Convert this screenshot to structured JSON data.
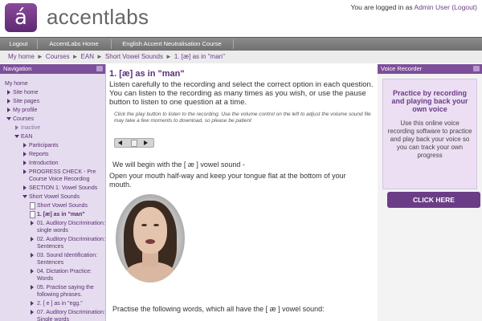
{
  "header": {
    "logo_glyph": "á",
    "logo_text": "accentlabs",
    "login_prefix": "You are logged in as ",
    "user_name": "Admin User",
    "logout_link": "(Logout)"
  },
  "navbar": {
    "items": [
      "Logout",
      "AccentLabs Home",
      "English Accent Neutralisation Course"
    ]
  },
  "breadcrumb": {
    "items": [
      "My home",
      "Courses",
      "EAN",
      "Short Vowel Sounds",
      "1. [æ] as in \"man\""
    ],
    "separator": "►"
  },
  "navigation": {
    "title": "Navigation",
    "tree": [
      {
        "label": "My home",
        "type": "link"
      },
      {
        "label": "Site home",
        "type": "bullet"
      },
      {
        "label": "Site pages",
        "type": "collapsed"
      },
      {
        "label": "My profile",
        "type": "collapsed"
      },
      {
        "label": "Courses",
        "type": "expanded"
      },
      {
        "label": "Inactive",
        "type": "collapsed-inactive"
      },
      {
        "label": "EAN",
        "type": "expanded"
      },
      {
        "label": "Participants",
        "type": "collapsed"
      },
      {
        "label": "Reports",
        "type": "collapsed"
      },
      {
        "label": "Introduction",
        "type": "collapsed"
      },
      {
        "label": "PROGRESS CHECK - Pre Course Voice Recording",
        "type": "collapsed"
      },
      {
        "label": "SECTION 1: Vowel Sounds",
        "type": "collapsed"
      },
      {
        "label": "Short Vowel Sounds",
        "type": "expanded"
      },
      {
        "label": "Short Vowel Sounds",
        "type": "doc"
      },
      {
        "label": "1. [æ] as in \"man\"",
        "type": "doc-current"
      },
      {
        "label": "01. Auditory Discrimination: single words",
        "type": "doc-collapsed"
      },
      {
        "label": "02. Auditory Discrimination: Sentences",
        "type": "doc-collapsed"
      },
      {
        "label": "03. Sound Identification: Sentences",
        "type": "doc-collapsed"
      },
      {
        "label": "04. Dictation Practice: Words",
        "type": "doc-collapsed"
      },
      {
        "label": "05. Practise saying the following phrases.",
        "type": "doc-collapsed"
      },
      {
        "label": "2. [ e ] as in \"egg.\"",
        "type": "doc-collapsed"
      },
      {
        "label": "07. Auditory Discrimination: Single words",
        "type": "doc-collapsed"
      }
    ]
  },
  "main": {
    "title": "1. [æ] as in \"man\"",
    "instructions": "Listen carefully to the recording and select the correct option in each question. You can listen to the recording as many times as you wish, or use the pause button to listen to one question at a time.",
    "note": "Click the play button to listen to the recording. Use the volume control on the left to adjust the volume sound file may take a few moments to download, so please be patient",
    "begin_text": "We will begin with the [ æ ] vowel sound -",
    "mouth_text": "Open your mouth half-way and keep your tongue flat at the bottom of your mouth.",
    "practise_text": "Practise the following words, which all have the [ æ ] vowel sound:"
  },
  "recorder": {
    "block_title": "Voice Recorder",
    "heading": "Practice by recording and playing back your own voice",
    "description": "Use this online voice recording software to practice and play back your voice so you can track your own progress",
    "button_label": "CLICK HERE"
  },
  "colors": {
    "brand_purple": "#6b3d86",
    "block_header": "#7d4f9a",
    "sidebar_bg": "#e6dcef"
  }
}
